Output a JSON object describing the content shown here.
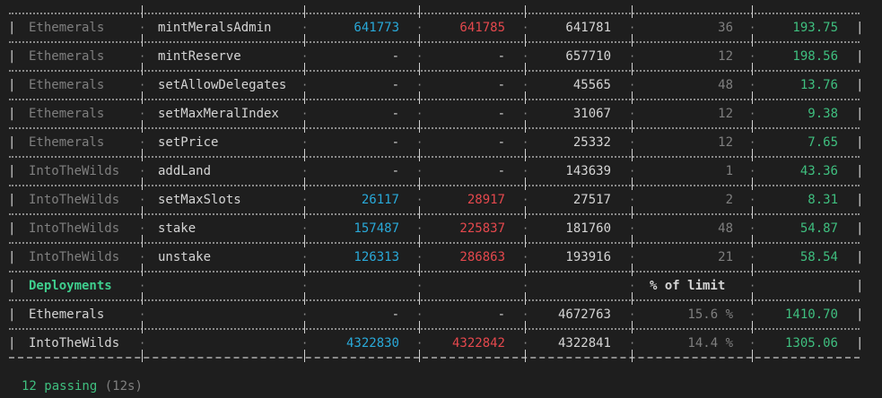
{
  "methods": [
    {
      "contract": "Ethemerals",
      "method": "mintMeralsAdmin",
      "min": "641773",
      "max": "641785",
      "avg": "641781",
      "calls": "36",
      "usd": "193.75"
    },
    {
      "contract": "Ethemerals",
      "method": "mintReserve",
      "min": "-",
      "max": "-",
      "avg": "657710",
      "calls": "12",
      "usd": "198.56"
    },
    {
      "contract": "Ethemerals",
      "method": "setAllowDelegates",
      "min": "-",
      "max": "-",
      "avg": "45565",
      "calls": "48",
      "usd": "13.76"
    },
    {
      "contract": "Ethemerals",
      "method": "setMaxMeralIndex",
      "min": "-",
      "max": "-",
      "avg": "31067",
      "calls": "12",
      "usd": "9.38"
    },
    {
      "contract": "Ethemerals",
      "method": "setPrice",
      "min": "-",
      "max": "-",
      "avg": "25332",
      "calls": "12",
      "usd": "7.65"
    },
    {
      "contract": "IntoTheWilds",
      "method": "addLand",
      "min": "-",
      "max": "-",
      "avg": "143639",
      "calls": "1",
      "usd": "43.36"
    },
    {
      "contract": "IntoTheWilds",
      "method": "setMaxSlots",
      "min": "26117",
      "max": "28917",
      "avg": "27517",
      "calls": "2",
      "usd": "8.31"
    },
    {
      "contract": "IntoTheWilds",
      "method": "stake",
      "min": "157487",
      "max": "225837",
      "avg": "181760",
      "calls": "48",
      "usd": "54.87"
    },
    {
      "contract": "IntoTheWilds",
      "method": "unstake",
      "min": "126313",
      "max": "286863",
      "avg": "193916",
      "calls": "21",
      "usd": "58.54"
    }
  ],
  "deployments_header": {
    "title": "Deployments",
    "limit_label": "% of limit"
  },
  "deployments": [
    {
      "name": "Ethemerals",
      "min": "-",
      "max": "-",
      "avg": "4672763",
      "pct": "15.6 %",
      "usd": "1410.70"
    },
    {
      "name": "IntoTheWilds",
      "min": "4322830",
      "max": "4322842",
      "avg": "4322841",
      "pct": "14.4 %",
      "usd": "1305.06"
    }
  ],
  "summary": {
    "passing": "12 passing",
    "duration": "(12s)"
  },
  "colors": {
    "min": "#29a9d9",
    "max": "#e5484d",
    "usd": "#3fbf7f",
    "deploy_title": "#3fcf8e"
  }
}
